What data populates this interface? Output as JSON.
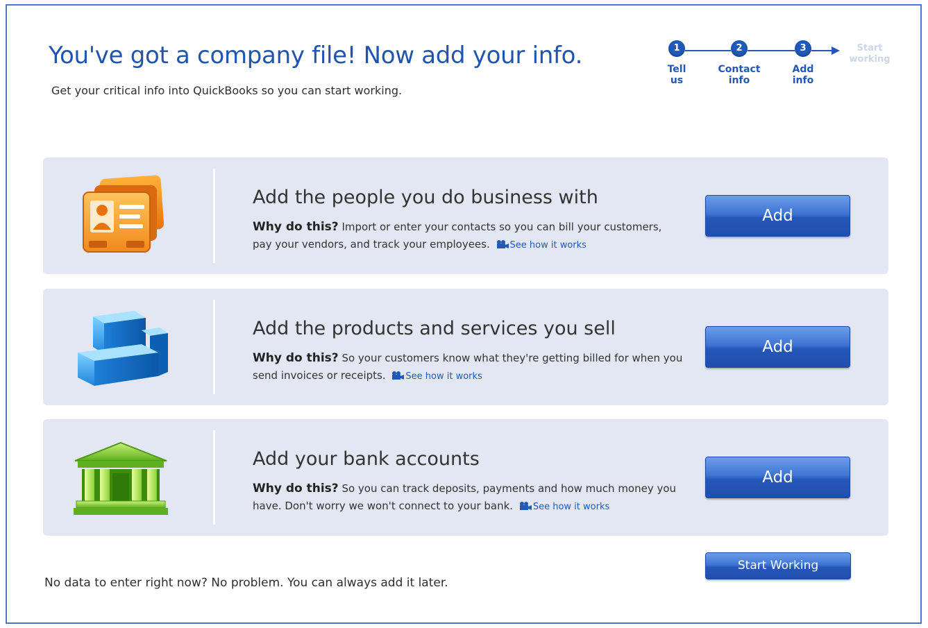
{
  "header": {
    "title": "You've got a company file! Now add your info.",
    "subtitle": "Get your critical info into QuickBooks so you can start working."
  },
  "steps": [
    {
      "number": "1",
      "label": "Tell\nus"
    },
    {
      "number": "2",
      "label": "Contact\ninfo"
    },
    {
      "number": "3",
      "label": "Add\ninfo"
    }
  ],
  "steps_final": "Start\nworking",
  "cards": [
    {
      "icon": "contact-card-icon",
      "title": "Add the people you do business with",
      "why_label": "Why do this?",
      "desc": "Import or enter your contacts so you can bill your customers, pay your vendors, and track your employees.",
      "link": "See how it works",
      "button": "Add"
    },
    {
      "icon": "product-boxes-icon",
      "title": "Add the products and services you sell",
      "why_label": "Why do this?",
      "desc": "So your customers know what they're getting billed for when you send invoices or receipts.",
      "link": "See how it works",
      "button": "Add"
    },
    {
      "icon": "bank-icon",
      "title": "Add your bank accounts",
      "why_label": "Why do this?",
      "desc": "So you can track deposits, payments and how much money you have. Don't worry we won't connect to your bank.",
      "link": "See how it works",
      "button": "Add"
    }
  ],
  "footer": {
    "note": "No data to enter right now? No problem. You can always add it later.",
    "start_button": "Start Working"
  },
  "colors": {
    "accent": "#2159b8",
    "card_bg": "#e3e7f3",
    "border": "#4a78c2"
  }
}
